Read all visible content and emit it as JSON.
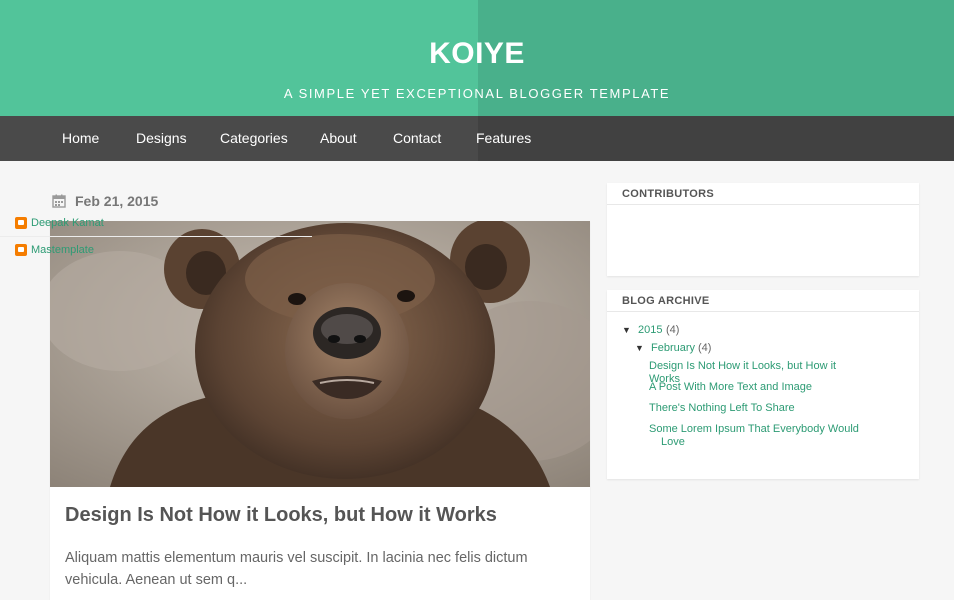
{
  "header": {
    "title": "KOIYE",
    "subtitle": "A SIMPLE YET EXCEPTIONAL BLOGGER TEMPLATE"
  },
  "nav": {
    "items": [
      "Home",
      "Designs",
      "Categories",
      "About",
      "Contact",
      "Features"
    ]
  },
  "post": {
    "date": "Feb 21, 2015",
    "title": "Design Is Not How it Looks, but How it Works",
    "excerpt": "Aliquam mattis elementum mauris vel suscipit. In lacinia nec felis dictum vehicula. Aenean ut sem q..."
  },
  "sidebar": {
    "contributors": {
      "heading": "CONTRIBUTORS",
      "people": [
        "Deepak Kamat",
        "Mastemplate"
      ]
    },
    "archive": {
      "heading": "BLOG ARCHIVE",
      "year": {
        "toggle": "▼",
        "label": "2015",
        "count": "(4)"
      },
      "month": {
        "toggle": "▼",
        "label": "February",
        "count": "(4)"
      },
      "posts": [
        "Design Is Not How it Looks, but How it Works",
        "A Post With More Text and Image",
        "There's Nothing Left To Share",
        "Some Lorem Ipsum That Everybody Would Love"
      ]
    }
  },
  "colors": {
    "header_green": "#52c49a",
    "nav_dark": "#4a4a4a",
    "link_green": "#2d9b74",
    "blogger_orange": "#f57d00"
  }
}
